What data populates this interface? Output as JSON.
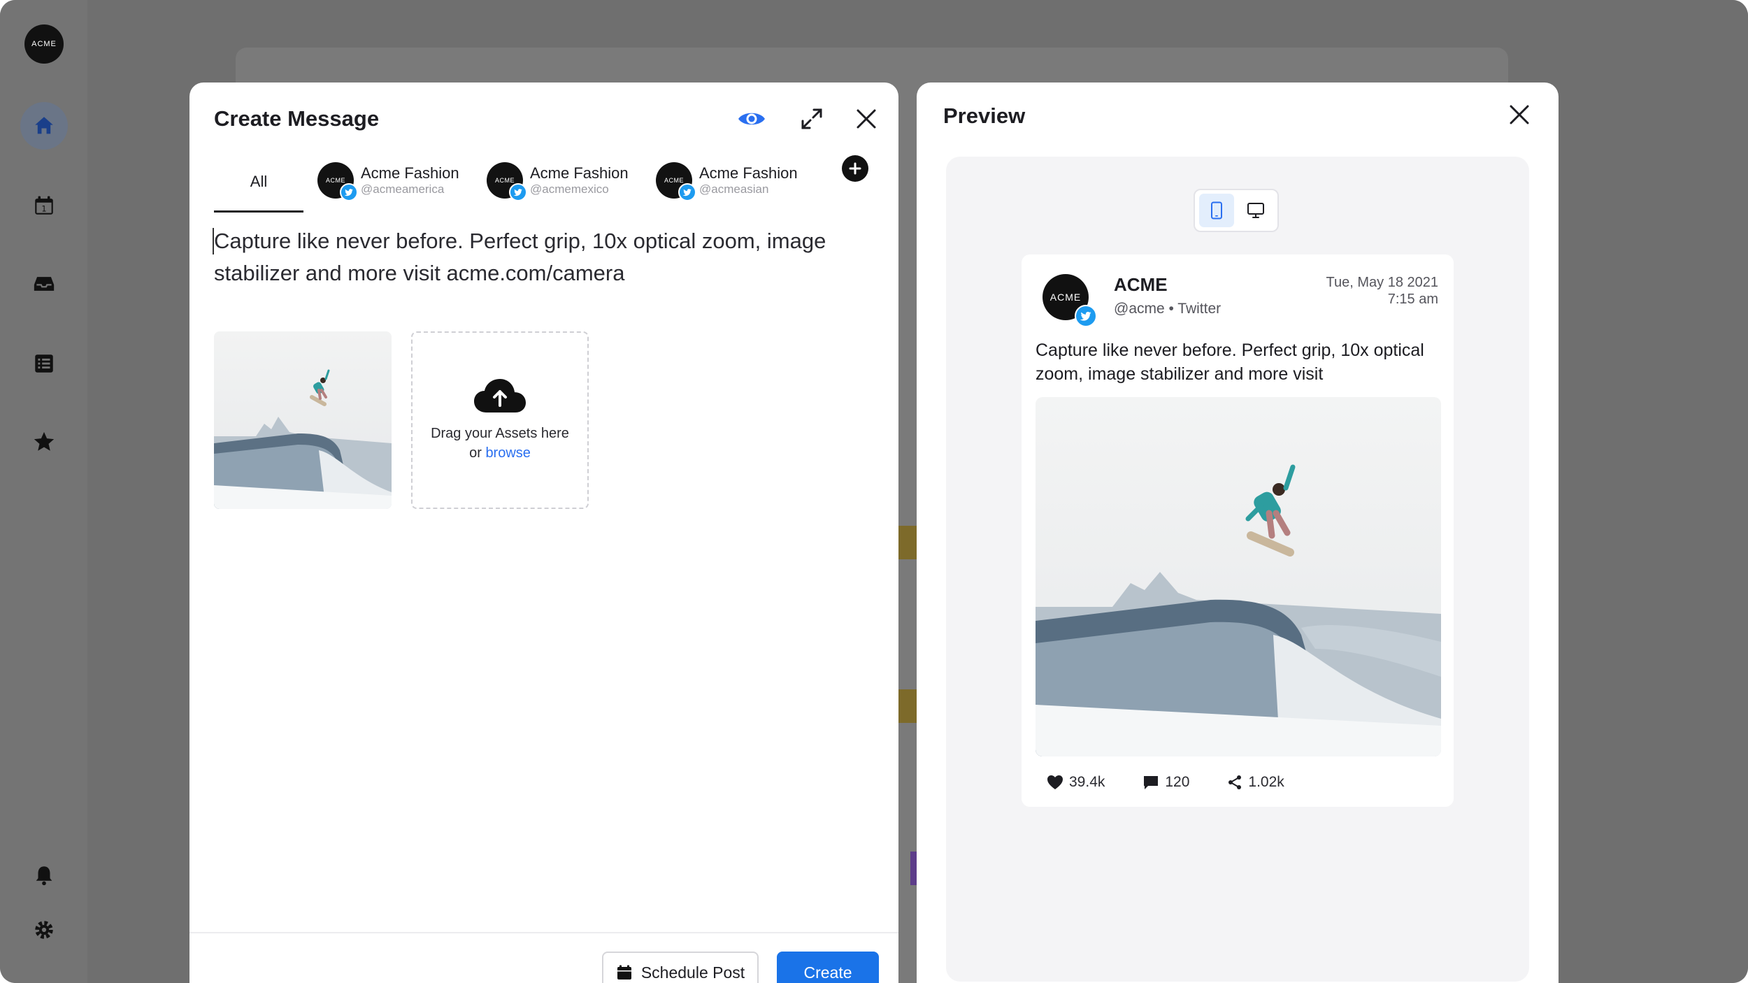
{
  "app": {
    "logo_text": "ACME"
  },
  "sidebar": {
    "items": [
      {
        "name": "home",
        "icon": "home-icon",
        "active": true
      },
      {
        "name": "calendar",
        "icon": "calendar-icon",
        "active": false
      },
      {
        "name": "inbox",
        "icon": "inbox-icon",
        "active": false
      },
      {
        "name": "list",
        "icon": "list-icon",
        "active": false
      },
      {
        "name": "favorites",
        "icon": "star-icon",
        "active": false
      },
      {
        "name": "notifications",
        "icon": "bell-icon",
        "active": false
      },
      {
        "name": "settings",
        "icon": "gear-icon",
        "active": false
      }
    ]
  },
  "create_message": {
    "title": "Create Message",
    "tab_all_label": "All",
    "accounts": [
      {
        "avatar_text": "ACME",
        "name": "Acme Fashion",
        "handle": "@acmeamerica"
      },
      {
        "avatar_text": "ACME",
        "name": "Acme Fashion",
        "handle": "@acmemexico"
      },
      {
        "avatar_text": "ACME",
        "name": "Acme Fashion",
        "handle": "@acmeasian"
      }
    ],
    "message_text": "Capture like never before. Perfect grip, 10x optical zoom, image stabilizer and more visit acme.com/camera",
    "drop_zone": {
      "line1": "Drag your Assets here",
      "or_text": "or",
      "browse_label": "browse"
    },
    "schedule_label": "Schedule Post",
    "create_label": "Create"
  },
  "preview": {
    "title": "Preview",
    "device_modes": [
      "mobile",
      "desktop"
    ],
    "active_device": "mobile",
    "tweet": {
      "avatar_text": "ACME",
      "name": "ACME",
      "handle_line": "@acme • Twitter",
      "date": "Tue, May 18 2021",
      "time": "7:15 am",
      "body": "Capture like never before. Perfect grip, 10x optical zoom, image stabilizer and more visit",
      "likes": "39.4k",
      "comments": "120",
      "shares": "1.02k"
    }
  },
  "colors": {
    "accent": "#1a73e8",
    "twitter": "#1d9bf0",
    "preview_icon": "#2a6ff0"
  }
}
